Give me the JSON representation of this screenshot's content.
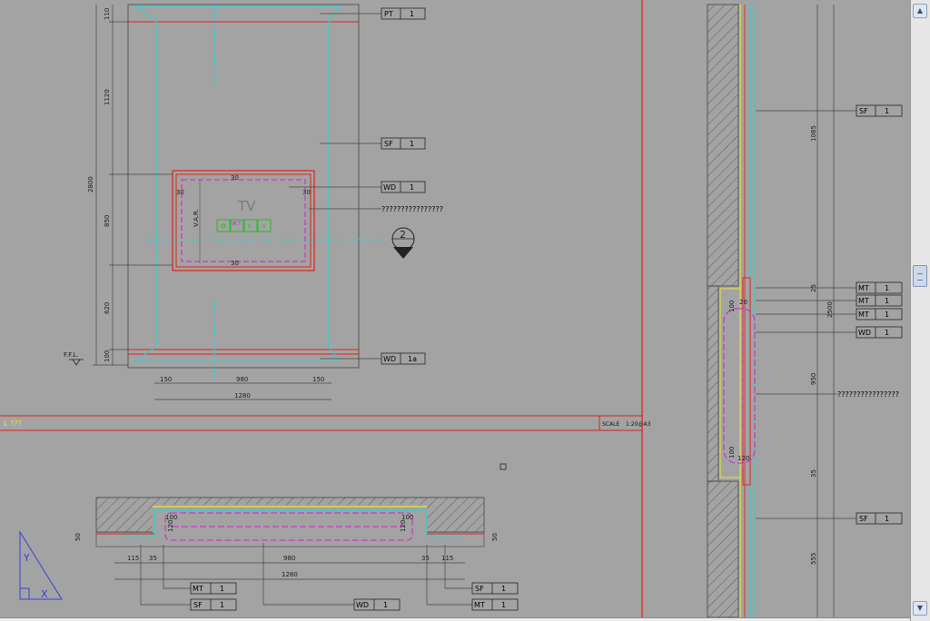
{
  "colors": {
    "background": "#a3a3a3",
    "red": "#e0201a",
    "cyan": "#25d4d4",
    "magenta": "#d21fd2",
    "yellow": "#e8e43a",
    "green": "#22c020",
    "line": "#3a3a3a"
  },
  "elevation": {
    "tv_label": "TV",
    "var_label": "V.A.R.",
    "detail_marker": "2",
    "ffl_label": "F.F.L.",
    "outlets": [
      "",
      "W.T",
      "S",
      "V"
    ],
    "dims_vertical": [
      "110",
      "1120",
      "2800",
      "850",
      "620",
      "100"
    ],
    "dims_frame": [
      "30",
      "30",
      "30",
      "30"
    ],
    "dims_horizontal": [
      "150",
      "980",
      "150"
    ],
    "dim_total": "1280",
    "callouts": [
      {
        "code": "PT",
        "num": "1"
      },
      {
        "code": "SF",
        "num": "1"
      },
      {
        "code": "WD",
        "num": "1"
      },
      {
        "note": "????????????????"
      },
      {
        "code": "WD",
        "num": "1a"
      }
    ]
  },
  "title_bar": {
    "title": "L ???",
    "scale_label": "SCALE",
    "scale_value": "1:20@A3"
  },
  "plan": {
    "dims_left": [
      "50",
      "115",
      "35"
    ],
    "dims_top": [
      "100",
      "120"
    ],
    "dims_top_right": [
      "100",
      "120"
    ],
    "dim_inner": "980",
    "dims_right": [
      "35",
      "115",
      "50"
    ],
    "dim_total": "1280",
    "callouts": [
      {
        "code": "MT",
        "num": "1"
      },
      {
        "code": "SF",
        "num": "1"
      },
      {
        "code": "WD",
        "num": "1"
      },
      {
        "code": "SF",
        "num": "1"
      },
      {
        "code": "MT",
        "num": "1"
      }
    ]
  },
  "section": {
    "dims": [
      "1085",
      "25",
      "2500",
      "20",
      "100",
      "950",
      "100",
      "120",
      "35",
      "555"
    ],
    "note": "????????????????",
    "callouts": [
      {
        "code": "SF",
        "num": "1"
      },
      {
        "code": "MT",
        "num": "1"
      },
      {
        "code": "MT",
        "num": "1"
      },
      {
        "code": "MT",
        "num": "1"
      },
      {
        "code": "WD",
        "num": "1"
      },
      {
        "code": "SF",
        "num": "1"
      }
    ]
  },
  "ucs": {
    "y": "Y",
    "x": "X"
  }
}
